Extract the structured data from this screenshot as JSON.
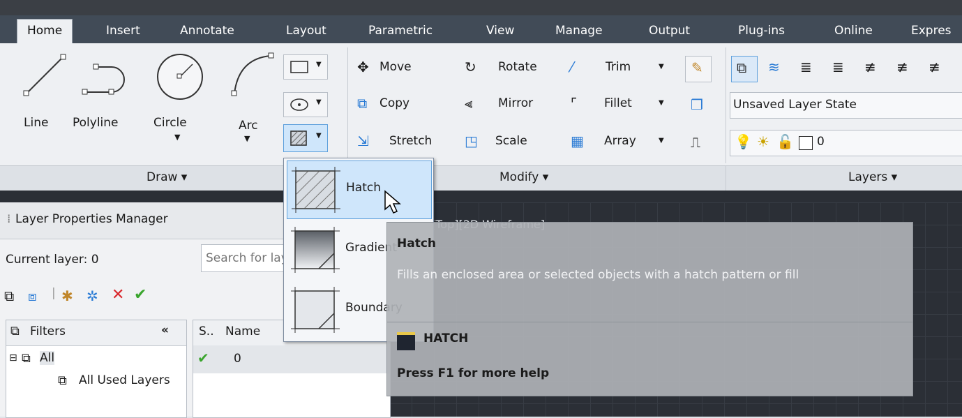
{
  "tabs": [
    "Home",
    "Insert",
    "Annotate",
    "Layout",
    "Parametric",
    "View",
    "Manage",
    "Output",
    "Plug-ins",
    "Online",
    "Expres"
  ],
  "draw": {
    "line": "Line",
    "polyline": "Polyline",
    "circle": "Circle",
    "arc": "Arc",
    "panel_title": "Draw"
  },
  "modify": {
    "move": "Move",
    "rotate": "Rotate",
    "trim": "Trim",
    "copy": "Copy",
    "mirror": "Mirror",
    "fillet": "Fillet",
    "stretch": "Stretch",
    "scale": "Scale",
    "array": "Array",
    "panel_title": "Modify"
  },
  "layers": {
    "state": "Unsaved Layer State",
    "current": "0",
    "panel_title": "Layers"
  },
  "hatch_menu": {
    "items": [
      "Hatch",
      "Gradient",
      "Boundary"
    ]
  },
  "tooltip": {
    "title": "Hatch",
    "description": "Fills an enclosed area or selected objects with a hatch pattern or fill",
    "command": "HATCH",
    "help": "Press F1 for more help"
  },
  "viewport": {
    "label": "[Top][2D Wireframe]"
  },
  "layer_manager": {
    "title": "Layer Properties Manager",
    "current_layer": "Current layer: 0",
    "search_placeholder": "Search for layer",
    "filters_label": "Filters",
    "collapse": "«",
    "tree": [
      "All",
      "All Used Layers"
    ],
    "columns": [
      "S..",
      "Name"
    ],
    "rows": [
      {
        "name": "0"
      }
    ]
  },
  "colors": {
    "ribbon_bg": "#eef0f3",
    "tab_bar": "#414b57",
    "selected_item": "#cfe6fb",
    "tooltip_bg": "#afb2b6",
    "viewport_bg": "#2b2f36",
    "check_green": "#3aa52d",
    "delete_red": "#d9262b"
  }
}
